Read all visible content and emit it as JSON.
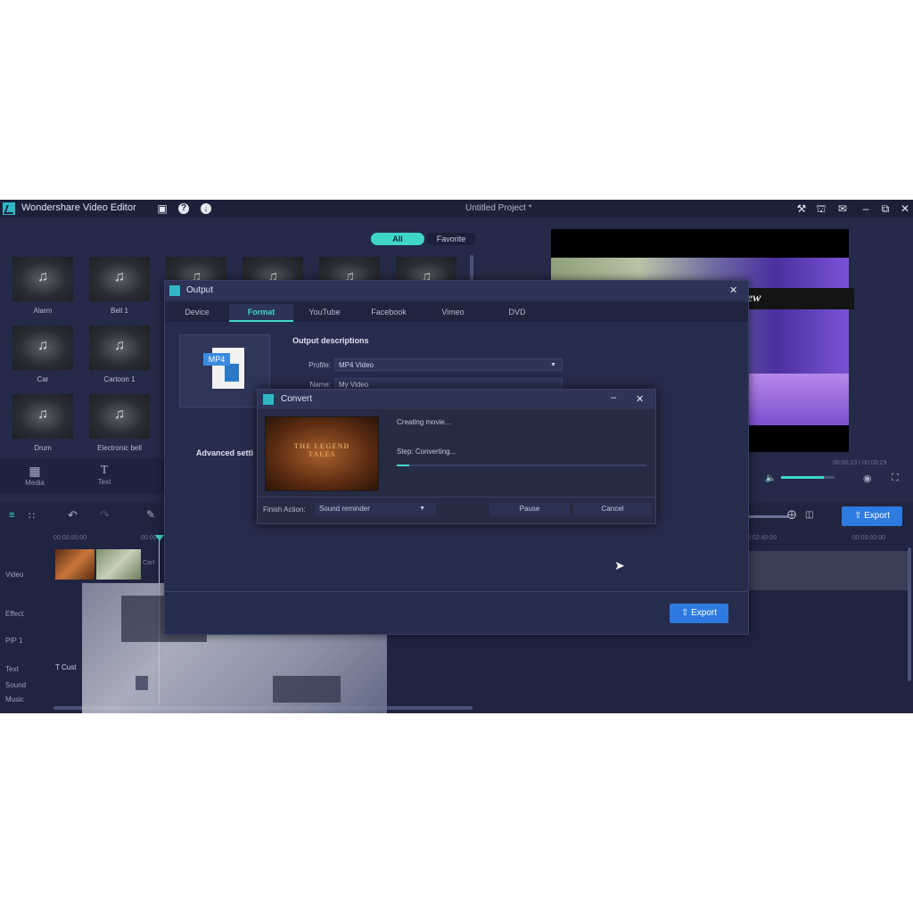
{
  "app": {
    "title": "Wondershare Video Editor",
    "project": "Untitled Project *"
  },
  "library": {
    "filters": [
      "All",
      "Favorite"
    ],
    "items": [
      {
        "label": "Alarm"
      },
      {
        "label": "Bell 1"
      },
      {
        "label": "Car"
      },
      {
        "label": "Cartoon 1"
      },
      {
        "label": "Drum"
      },
      {
        "label": "Electronic bell"
      }
    ],
    "tools": [
      {
        "label": "Media"
      },
      {
        "label": "Text"
      }
    ]
  },
  "preview": {
    "overlay_text": "iew",
    "time": "00:00:23 / 00:00:29"
  },
  "timeline": {
    "ruler": [
      "00:00:00:00",
      "00:00",
      "0:02:40:00",
      "00:03:00:00"
    ],
    "tracks": [
      "Video",
      "Effect",
      "PIP 1",
      "Text",
      "Sound",
      "Music"
    ],
    "clip_label": "Cart",
    "text_clip": "T Cust",
    "export_label": "Export"
  },
  "output": {
    "title": "Output",
    "tabs": [
      "Device",
      "Format",
      "YouTube",
      "Facebook",
      "Vimeo",
      "DVD"
    ],
    "format_badge": "MP4",
    "section": "Output descriptions",
    "profile_label": "Profile:",
    "profile_value": "MP4 Video",
    "name_label": "Name:",
    "name_value": "My Video",
    "advanced": "Advanced setti",
    "export_label": "Export"
  },
  "convert": {
    "title": "Convert",
    "status": "Creating movie...",
    "step": "Step: Converting...",
    "progress": 0.05,
    "thumb_text": "THE LEGEND TALES",
    "finish_label": "Finish Action:",
    "finish_value": "Sound reminder",
    "pause_label": "Pause",
    "cancel_label": "Cancel"
  }
}
